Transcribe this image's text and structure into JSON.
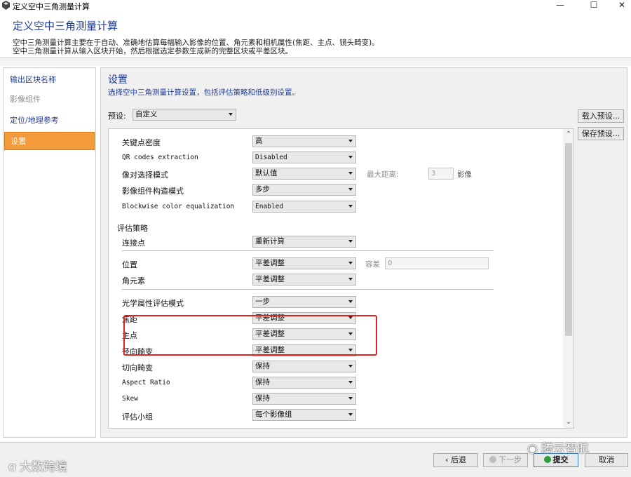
{
  "window": {
    "title": "定义空中三角测量计算"
  },
  "header": {
    "title": "定义空中三角测量计算",
    "desc1": "空中三角测量计算主要在于自动、准确地估算每幅输入影像的位置、角元素和相机属性(焦距、主点、镜头畸变)。",
    "desc2": "空中三角测量计算从输入区块开始，然后根据选定参数生成新的完整区块或平差区块。"
  },
  "nav": {
    "items": [
      {
        "label": "输出区块名称"
      },
      {
        "label": "影像组件"
      },
      {
        "label": "定位/地理参考"
      },
      {
        "label": "设置"
      }
    ]
  },
  "settings": {
    "title": "设置",
    "subtitle": "选择空中三角测量计算设置，包括评估策略和低级别设置。",
    "preset_label": "预设:",
    "preset_value": "自定义",
    "load_preset": "载入预设...",
    "save_preset": "保存预设...",
    "rows": {
      "keypoint_density": {
        "label": "关键点密度",
        "value": "高"
      },
      "qr_codes": {
        "label": "QR codes extraction",
        "value": "Disabled"
      },
      "pair_selection": {
        "label": "像对选择模式",
        "value": "默认值",
        "max_distance_label": "最大距离:",
        "max_distance_value": "3",
        "max_distance_unit": "影像"
      },
      "component_mode": {
        "label": "影像组件构造模式",
        "value": "多步"
      },
      "blockwise_color": {
        "label": "Blockwise color equalization",
        "value": "Enabled"
      },
      "strategy_group": "评估策略",
      "tie_points": {
        "label": "连接点",
        "value": "重新计算"
      },
      "position": {
        "label": "位置",
        "value": "平差调整",
        "tolerance_label": "容差",
        "tolerance_value": "0"
      },
      "rotation": {
        "label": "角元素",
        "value": "平差调整"
      },
      "optical_mode": {
        "label": "光学属性评估模式",
        "value": "一步"
      },
      "focal_length": {
        "label": "焦距",
        "value": "平差调整"
      },
      "principal_point": {
        "label": "主点",
        "value": "平差调整"
      },
      "radial_distortion": {
        "label": "径向畸变",
        "value": "平差调整"
      },
      "tangential_distortion": {
        "label": "切向畸变",
        "value": "保持"
      },
      "aspect_ratio": {
        "label": "Aspect Ratio",
        "value": "保持"
      },
      "skew": {
        "label": "Skew",
        "value": "保持"
      },
      "estimation_group": {
        "label": "评估小组",
        "value": "每个影像组"
      }
    }
  },
  "footer": {
    "back": "后退",
    "next": "下一步",
    "submit": "提交",
    "cancel": "取消"
  },
  "watermarks": {
    "left": "大数跨境",
    "right": "腾云智航"
  },
  "colors": {
    "title_blue": "#1f3c9a",
    "active_orange": "#f39a3c",
    "highlight_red": "#e0241f"
  }
}
